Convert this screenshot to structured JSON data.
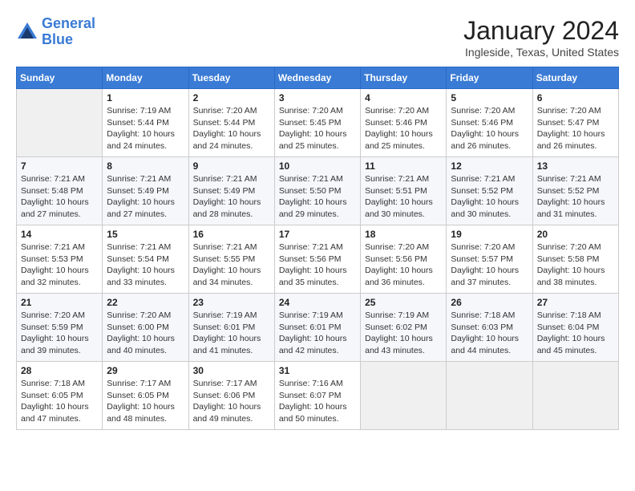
{
  "header": {
    "logo_line1": "General",
    "logo_line2": "Blue",
    "month_title": "January 2024",
    "location": "Ingleside, Texas, United States"
  },
  "days_of_week": [
    "Sunday",
    "Monday",
    "Tuesday",
    "Wednesday",
    "Thursday",
    "Friday",
    "Saturday"
  ],
  "weeks": [
    [
      {
        "day": "",
        "sunrise": "",
        "sunset": "",
        "daylight": ""
      },
      {
        "day": "1",
        "sunrise": "Sunrise: 7:19 AM",
        "sunset": "Sunset: 5:44 PM",
        "daylight": "Daylight: 10 hours and 24 minutes."
      },
      {
        "day": "2",
        "sunrise": "Sunrise: 7:20 AM",
        "sunset": "Sunset: 5:44 PM",
        "daylight": "Daylight: 10 hours and 24 minutes."
      },
      {
        "day": "3",
        "sunrise": "Sunrise: 7:20 AM",
        "sunset": "Sunset: 5:45 PM",
        "daylight": "Daylight: 10 hours and 25 minutes."
      },
      {
        "day": "4",
        "sunrise": "Sunrise: 7:20 AM",
        "sunset": "Sunset: 5:46 PM",
        "daylight": "Daylight: 10 hours and 25 minutes."
      },
      {
        "day": "5",
        "sunrise": "Sunrise: 7:20 AM",
        "sunset": "Sunset: 5:46 PM",
        "daylight": "Daylight: 10 hours and 26 minutes."
      },
      {
        "day": "6",
        "sunrise": "Sunrise: 7:20 AM",
        "sunset": "Sunset: 5:47 PM",
        "daylight": "Daylight: 10 hours and 26 minutes."
      }
    ],
    [
      {
        "day": "7",
        "sunrise": "Sunrise: 7:21 AM",
        "sunset": "Sunset: 5:48 PM",
        "daylight": "Daylight: 10 hours and 27 minutes."
      },
      {
        "day": "8",
        "sunrise": "Sunrise: 7:21 AM",
        "sunset": "Sunset: 5:49 PM",
        "daylight": "Daylight: 10 hours and 27 minutes."
      },
      {
        "day": "9",
        "sunrise": "Sunrise: 7:21 AM",
        "sunset": "Sunset: 5:49 PM",
        "daylight": "Daylight: 10 hours and 28 minutes."
      },
      {
        "day": "10",
        "sunrise": "Sunrise: 7:21 AM",
        "sunset": "Sunset: 5:50 PM",
        "daylight": "Daylight: 10 hours and 29 minutes."
      },
      {
        "day": "11",
        "sunrise": "Sunrise: 7:21 AM",
        "sunset": "Sunset: 5:51 PM",
        "daylight": "Daylight: 10 hours and 30 minutes."
      },
      {
        "day": "12",
        "sunrise": "Sunrise: 7:21 AM",
        "sunset": "Sunset: 5:52 PM",
        "daylight": "Daylight: 10 hours and 30 minutes."
      },
      {
        "day": "13",
        "sunrise": "Sunrise: 7:21 AM",
        "sunset": "Sunset: 5:52 PM",
        "daylight": "Daylight: 10 hours and 31 minutes."
      }
    ],
    [
      {
        "day": "14",
        "sunrise": "Sunrise: 7:21 AM",
        "sunset": "Sunset: 5:53 PM",
        "daylight": "Daylight: 10 hours and 32 minutes."
      },
      {
        "day": "15",
        "sunrise": "Sunrise: 7:21 AM",
        "sunset": "Sunset: 5:54 PM",
        "daylight": "Daylight: 10 hours and 33 minutes."
      },
      {
        "day": "16",
        "sunrise": "Sunrise: 7:21 AM",
        "sunset": "Sunset: 5:55 PM",
        "daylight": "Daylight: 10 hours and 34 minutes."
      },
      {
        "day": "17",
        "sunrise": "Sunrise: 7:21 AM",
        "sunset": "Sunset: 5:56 PM",
        "daylight": "Daylight: 10 hours and 35 minutes."
      },
      {
        "day": "18",
        "sunrise": "Sunrise: 7:20 AM",
        "sunset": "Sunset: 5:56 PM",
        "daylight": "Daylight: 10 hours and 36 minutes."
      },
      {
        "day": "19",
        "sunrise": "Sunrise: 7:20 AM",
        "sunset": "Sunset: 5:57 PM",
        "daylight": "Daylight: 10 hours and 37 minutes."
      },
      {
        "day": "20",
        "sunrise": "Sunrise: 7:20 AM",
        "sunset": "Sunset: 5:58 PM",
        "daylight": "Daylight: 10 hours and 38 minutes."
      }
    ],
    [
      {
        "day": "21",
        "sunrise": "Sunrise: 7:20 AM",
        "sunset": "Sunset: 5:59 PM",
        "daylight": "Daylight: 10 hours and 39 minutes."
      },
      {
        "day": "22",
        "sunrise": "Sunrise: 7:20 AM",
        "sunset": "Sunset: 6:00 PM",
        "daylight": "Daylight: 10 hours and 40 minutes."
      },
      {
        "day": "23",
        "sunrise": "Sunrise: 7:19 AM",
        "sunset": "Sunset: 6:01 PM",
        "daylight": "Daylight: 10 hours and 41 minutes."
      },
      {
        "day": "24",
        "sunrise": "Sunrise: 7:19 AM",
        "sunset": "Sunset: 6:01 PM",
        "daylight": "Daylight: 10 hours and 42 minutes."
      },
      {
        "day": "25",
        "sunrise": "Sunrise: 7:19 AM",
        "sunset": "Sunset: 6:02 PM",
        "daylight": "Daylight: 10 hours and 43 minutes."
      },
      {
        "day": "26",
        "sunrise": "Sunrise: 7:18 AM",
        "sunset": "Sunset: 6:03 PM",
        "daylight": "Daylight: 10 hours and 44 minutes."
      },
      {
        "day": "27",
        "sunrise": "Sunrise: 7:18 AM",
        "sunset": "Sunset: 6:04 PM",
        "daylight": "Daylight: 10 hours and 45 minutes."
      }
    ],
    [
      {
        "day": "28",
        "sunrise": "Sunrise: 7:18 AM",
        "sunset": "Sunset: 6:05 PM",
        "daylight": "Daylight: 10 hours and 47 minutes."
      },
      {
        "day": "29",
        "sunrise": "Sunrise: 7:17 AM",
        "sunset": "Sunset: 6:05 PM",
        "daylight": "Daylight: 10 hours and 48 minutes."
      },
      {
        "day": "30",
        "sunrise": "Sunrise: 7:17 AM",
        "sunset": "Sunset: 6:06 PM",
        "daylight": "Daylight: 10 hours and 49 minutes."
      },
      {
        "day": "31",
        "sunrise": "Sunrise: 7:16 AM",
        "sunset": "Sunset: 6:07 PM",
        "daylight": "Daylight: 10 hours and 50 minutes."
      },
      {
        "day": "",
        "sunrise": "",
        "sunset": "",
        "daylight": ""
      },
      {
        "day": "",
        "sunrise": "",
        "sunset": "",
        "daylight": ""
      },
      {
        "day": "",
        "sunrise": "",
        "sunset": "",
        "daylight": ""
      }
    ]
  ]
}
